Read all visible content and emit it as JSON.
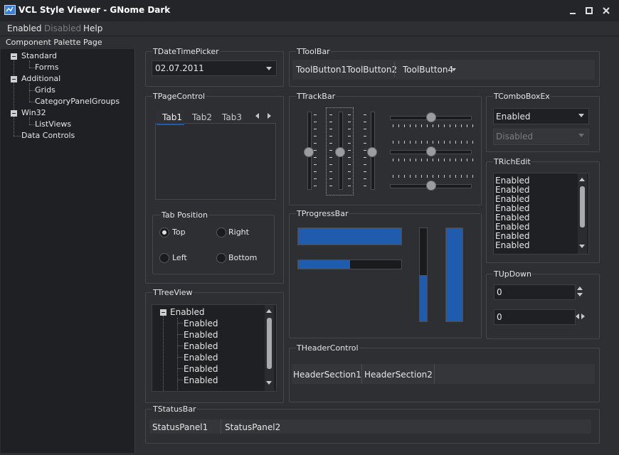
{
  "window": {
    "title": "VCL Style Viewer - GNome Dark",
    "icon": "app-icon"
  },
  "menu": {
    "items": [
      "Enabled",
      "Disabled",
      "Help"
    ]
  },
  "left_panel": {
    "title": "Component Palette Page",
    "tree": [
      {
        "label": "Standard",
        "children": [
          "Forms"
        ]
      },
      {
        "label": "Additional",
        "children": [
          "Grids",
          "CategoryPanelGroups"
        ]
      },
      {
        "label": "Win32",
        "children": [
          "ListViews"
        ]
      },
      {
        "label": "Data Controls",
        "children": []
      }
    ]
  },
  "datetimepicker": {
    "title": "TDateTimePicker",
    "value": "02.07.2011"
  },
  "toolbar": {
    "title": "TToolBar",
    "buttons": [
      "ToolButton1",
      "ToolButton2",
      "ToolButton4"
    ]
  },
  "pagecontrol": {
    "title": "TPageControl",
    "tabs": [
      "Tab1",
      "Tab2",
      "Tab3"
    ]
  },
  "tabposition": {
    "title": "Tab Position",
    "options": [
      "Top",
      "Right",
      "Left",
      "Bottom"
    ],
    "selected": "Top"
  },
  "trackbar": {
    "title": "TTrackBar"
  },
  "comboboxex": {
    "title": "TComboBoxEx",
    "enabled_value": "Enabled",
    "disabled_value": "Disabled"
  },
  "richedit": {
    "title": "TRichEdit",
    "lines": [
      "Enabled",
      "Enabled",
      "Enabled",
      "Enabled",
      "Enabled",
      "Enabled",
      "Enabled",
      "Enabled"
    ]
  },
  "progressbar": {
    "title": "TProgressBar",
    "h1_fraction": 1.0,
    "h2_fraction": 0.5,
    "v1_fraction": 0.5,
    "v2_fraction": 1.0,
    "accent": "#1f5cad"
  },
  "updown": {
    "title": "TUpDown",
    "value1": "0",
    "value2": "0"
  },
  "treeview": {
    "title": "TTreeView",
    "root": "Enabled",
    "children": [
      "Enabled",
      "Enabled",
      "Enabled",
      "Enabled",
      "Enabled",
      "Enabled"
    ]
  },
  "headercontrol": {
    "title": "THeaderControl",
    "sections": [
      "HeaderSection1",
      "HeaderSection2"
    ]
  },
  "statusbar": {
    "title": "TStatusBar",
    "panels": [
      "StatusPanel1",
      "StatusPanel2"
    ]
  }
}
